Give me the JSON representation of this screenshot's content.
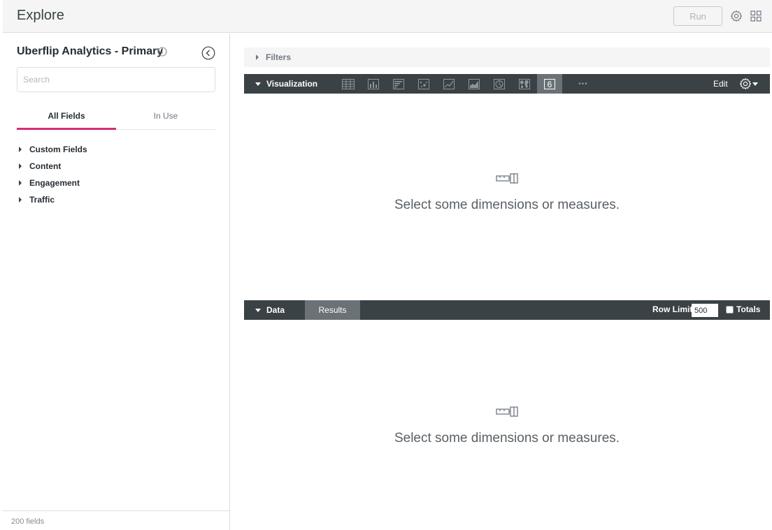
{
  "header": {
    "title": "Explore",
    "run_label": "Run",
    "settings_icon": "gear-icon",
    "apps_icon": "grid-icon"
  },
  "sidebar": {
    "model_title": "Uberflip Analytics - Primary",
    "search_placeholder": "Search",
    "tabs": [
      {
        "label": "All Fields",
        "active": true
      },
      {
        "label": "In Use",
        "active": false
      }
    ],
    "fields": [
      {
        "label": "Custom Fields"
      },
      {
        "label": "Content"
      },
      {
        "label": "Engagement"
      },
      {
        "label": "Traffic"
      }
    ],
    "footer": "200 fields"
  },
  "main": {
    "filters_label": "Filters",
    "visualization": {
      "label": "Visualization",
      "icons": [
        "table-icon",
        "column-chart-icon",
        "bar-chart-icon",
        "scatter-icon",
        "line-chart-icon",
        "area-chart-icon",
        "pie-chart-icon",
        "map-icon",
        "single-value-icon"
      ],
      "single_value_glyph": "6",
      "more_label": "•••",
      "edit_label": "Edit",
      "empty_text": "Select some dimensions or measures."
    },
    "data": {
      "label": "Data",
      "results_label": "Results",
      "row_limit_label": "Row Limit",
      "row_limit_value": "500",
      "totals_label": "Totals",
      "empty_text": "Select some dimensions or measures."
    }
  },
  "colors": {
    "accent": "#d62d74",
    "dark_bar": "#3a4245",
    "selected_tab": "#6a7177"
  }
}
